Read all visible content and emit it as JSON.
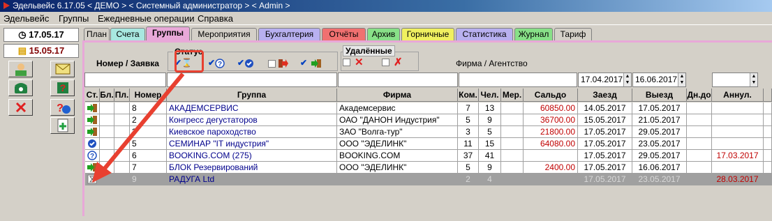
{
  "window": {
    "title": "Эдельвейс 6.17.05 < ДЕМО > < Системный администратор > < Admin >"
  },
  "menu": [
    "Эдельвейс",
    "Группы",
    "Ежедневные операции",
    "Справка"
  ],
  "sidebar": {
    "date1": "17.05.17",
    "date2": "15.05.17"
  },
  "tabs": [
    {
      "label": "План",
      "color": "#d4d0c8"
    },
    {
      "label": "Счета",
      "color": "#a8e8e0"
    },
    {
      "label": "Группы",
      "color": "#e8a8d8"
    },
    {
      "label": "Мероприятия",
      "color": "#d4d0c8"
    },
    {
      "label": "Бухгалтерия",
      "color": "#b8b0f0"
    },
    {
      "label": "Отчёты",
      "color": "#f07070"
    },
    {
      "label": "Архив",
      "color": "#88e088"
    },
    {
      "label": "Горничные",
      "color": "#f0f060"
    },
    {
      "label": "Статистика",
      "color": "#b8b0f0"
    },
    {
      "label": "Журнал",
      "color": "#88e088"
    },
    {
      "label": "Тариф",
      "color": "#d4d0c8"
    }
  ],
  "filters": {
    "number_label": "Номер / Заявка",
    "status_label": "Статус",
    "deleted_label": "Удалённые",
    "firm_label": "Фирма / Агентство",
    "date_from": "17.04.2017",
    "date_to": "16.06.2017"
  },
  "table": {
    "headers": [
      "Ст.",
      "Бл.",
      "Пл.",
      "Номер",
      "Группа",
      "Фирма",
      "Ком.",
      "Чел.",
      "Мер.",
      "Сальдо",
      "Заезд",
      "Выезд",
      "Дн.до",
      "Аннул."
    ],
    "rows": [
      {
        "status": "arrow",
        "num": "8",
        "group": "АКАДЕМСЕРВИС",
        "firm": "Академсервис",
        "rooms": "7",
        "people": "13",
        "saldo": "60850.00",
        "in": "14.05.2017",
        "out": "17.05.2017",
        "annul": ""
      },
      {
        "status": "arrow",
        "num": "2",
        "group": "Конгресс дегустаторов",
        "firm": "ОАО \"ДАНОН Индустрия\"",
        "rooms": "5",
        "people": "9",
        "saldo": "36700.00",
        "in": "15.05.2017",
        "out": "21.05.2017",
        "annul": ""
      },
      {
        "status": "arrow",
        "num": "3",
        "group": "Киевское пароходство",
        "firm": "ЗАО \"Волга-тур\"",
        "rooms": "3",
        "people": "5",
        "saldo": "21800.00",
        "in": "17.05.2017",
        "out": "29.05.2017",
        "annul": ""
      },
      {
        "status": "check",
        "num": "5",
        "group": "СЕМИНАР \"IT индустрия\"",
        "firm": "ООО \"ЭДЕЛИНК\"",
        "rooms": "11",
        "people": "15",
        "saldo": "64080.00",
        "in": "17.05.2017",
        "out": "23.05.2017",
        "annul": ""
      },
      {
        "status": "question",
        "num": "6",
        "group": "BOOKING.COM (275)",
        "firm": "BOOKING.COM",
        "rooms": "37",
        "people": "41",
        "saldo": "",
        "in": "17.05.2017",
        "out": "29.05.2017",
        "annul": "17.03.2017"
      },
      {
        "status": "arrow",
        "num": "7",
        "group": "БЛОК Резервирований",
        "firm": "ООО \"ЭДЕЛИНК\"",
        "rooms": "5",
        "people": "9",
        "saldo": "2400.00",
        "in": "17.05.2017",
        "out": "16.06.2017",
        "annul": ""
      },
      {
        "status": "hourglass",
        "num": "9",
        "group": "РАДУГА Ltd",
        "firm": "",
        "rooms": "2",
        "people": "4",
        "saldo": "",
        "in": "17.05.2017",
        "out": "23.05.2017",
        "annul": "28.03.2017"
      }
    ]
  }
}
